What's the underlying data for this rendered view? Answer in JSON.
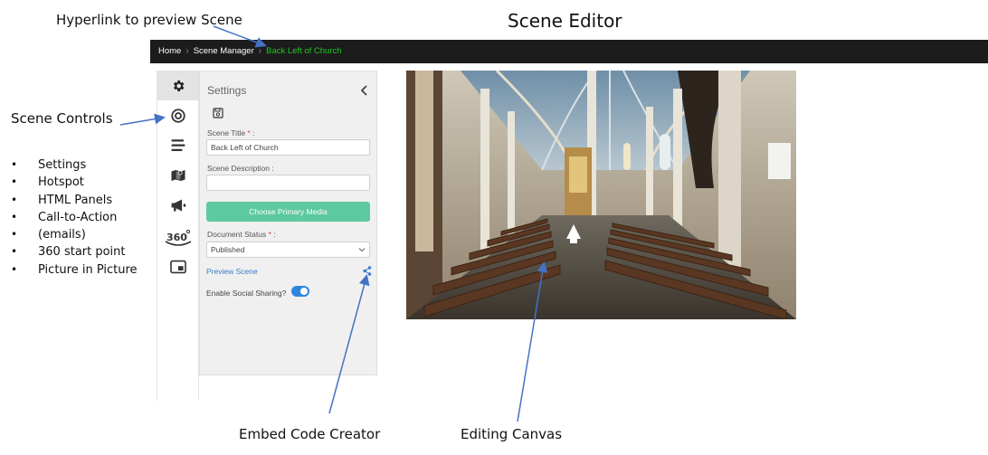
{
  "annotations": {
    "hyperlink_note": "Hyperlink to preview Scene",
    "page_heading": "Scene Editor",
    "scene_controls": "Scene Controls",
    "controls_list": [
      "Settings",
      "Hotspot",
      "HTML Panels",
      "Call-to-Action",
      "(emails)",
      "360 start point",
      "Picture in Picture"
    ],
    "embed_note": "Embed Code Creator",
    "canvas_note": "Editing Canvas"
  },
  "breadcrumb": {
    "home": "Home",
    "manager": "Scene Manager",
    "current": "Back Left of Church"
  },
  "sidebar_icons": [
    "gear-icon",
    "target-icon",
    "list-icon",
    "map-icon",
    "megaphone-icon",
    "360-icon",
    "picture-in-picture-icon"
  ],
  "settings": {
    "title": "Settings",
    "scene_title_label": "Scene Title",
    "scene_title_value": "Back Left of Church",
    "scene_description_label": "Scene Description :",
    "scene_description_value": "",
    "primary_media_button": "Choose Primary Media",
    "document_status_label": "Document Status",
    "document_status_value": "Published",
    "preview_link": "Preview Scene",
    "social_label": "Enable Social Sharing?",
    "social_enabled": true
  },
  "colors": {
    "topbar": "#1c1c1c",
    "breadcrumb_active": "#1fc91f",
    "primary_button": "#5dc9a0",
    "link": "#3a7bc8",
    "toggle": "#2e86de",
    "arrow": "#4472c4"
  }
}
